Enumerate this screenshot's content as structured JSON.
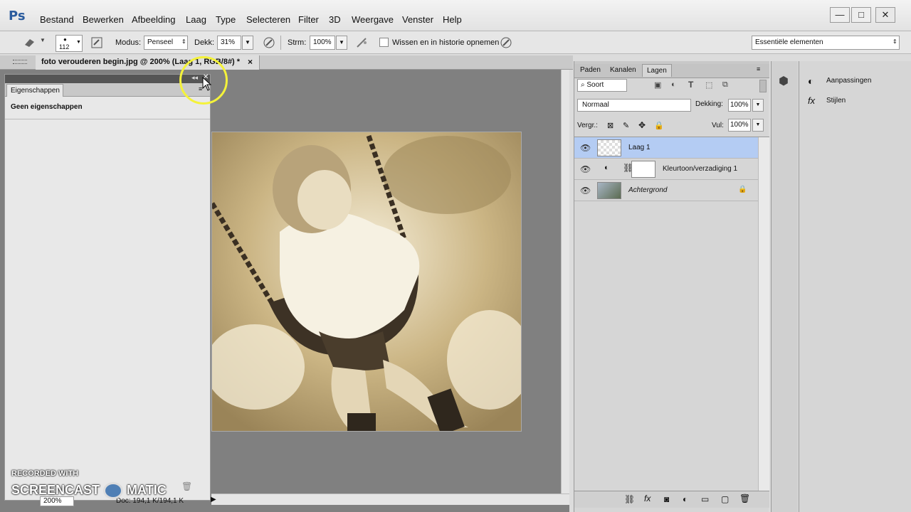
{
  "app": {
    "logo": "Ps"
  },
  "menu": [
    "Bestand",
    "Bewerken",
    "Afbeelding",
    "Laag",
    "Type",
    "Selecteren",
    "Filter",
    "3D",
    "Weergave",
    "Venster",
    "Help"
  ],
  "window_controls": {
    "minimize": "—",
    "maximize": "□",
    "close": "✕"
  },
  "options": {
    "brush_size": "112",
    "modus_label": "Modus:",
    "modus_value": "Penseel",
    "dekk_label": "Dekk:",
    "dekk_value": "31%",
    "strm_label": "Strm:",
    "strm_value": "100%",
    "history_label": "Wissen en in historie opnemen",
    "workspace": "Essentiële elementen"
  },
  "document": {
    "tab_title": "foto verouderen begin.jpg @ 200% (Laag 1, RGB/8#) *",
    "close": "×",
    "zoom": "200%",
    "doc_info": "Doc: 194,1 K/194,1 K"
  },
  "properties": {
    "tab": "Eigenschappen",
    "empty_text": "Geen eigenschappen"
  },
  "layers_panel": {
    "tabs": [
      "Paden",
      "Kanalen",
      "Lagen"
    ],
    "filter_label": "Soort",
    "blend_mode": "Normaal",
    "opacity_label": "Dekking:",
    "opacity_value": "100%",
    "lock_label": "Vergr.:",
    "fill_label": "Vul:",
    "fill_value": "100%",
    "layers": [
      {
        "name": "Laag 1",
        "selected": true
      },
      {
        "name": "Kleurtoon/verzadiging 1",
        "selected": false
      },
      {
        "name": "Achtergrond",
        "selected": false
      }
    ]
  },
  "side_panel": {
    "items": [
      "Aanpassingen",
      "Stijlen"
    ]
  },
  "watermark": {
    "line1": "RECORDED WITH",
    "line2": "SCREENCAST",
    "line3": "MATIC"
  },
  "colors": {
    "selected_layer": "#b4ccf3",
    "sepia": "#d9c7a0",
    "highlight_ring": "#f4f23a"
  }
}
